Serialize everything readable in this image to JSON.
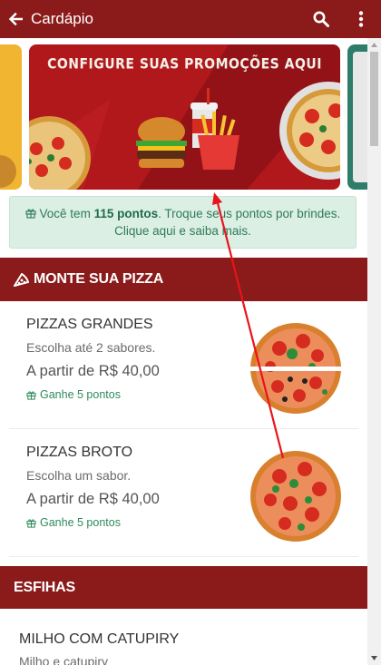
{
  "header": {
    "title": "Cardápio",
    "back_icon": "arrow-left-icon",
    "search_icon": "search-icon",
    "menu_icon": "kebab-menu-icon"
  },
  "carousel": {
    "banner_title": "CONFIGURE SUAS PROMOÇÕES AQUI"
  },
  "points": {
    "prefix": "Você tem ",
    "points": "115 pontos",
    "suffix": ". Troque seus pontos por brindes.",
    "line2": "Clique aqui e saiba mais."
  },
  "sections": [
    {
      "title": "MONTE SUA PIZZA",
      "icon": "pizza-slice-icon",
      "items": [
        {
          "name": "PIZZAS GRANDES",
          "description": "Escolha até 2 sabores.",
          "price": "A partir de R$ 40,00",
          "earn": "Ganhe 5 pontos"
        },
        {
          "name": "PIZZAS BROTO",
          "description": "Escolha um sabor.",
          "price": "A partir de R$ 40,00",
          "earn": "Ganhe 5 pontos"
        }
      ]
    },
    {
      "title": "ESFIHAS",
      "items": [
        {
          "name": "MILHO COM CATUPIRY",
          "description": "Milho e catupiry"
        }
      ]
    }
  ],
  "colors": {
    "primary": "#8b1a1a",
    "banner": "#b0181c",
    "points_bg": "#dbefe4",
    "points_text": "#2f7a5a",
    "annotation": "#e8141b"
  }
}
